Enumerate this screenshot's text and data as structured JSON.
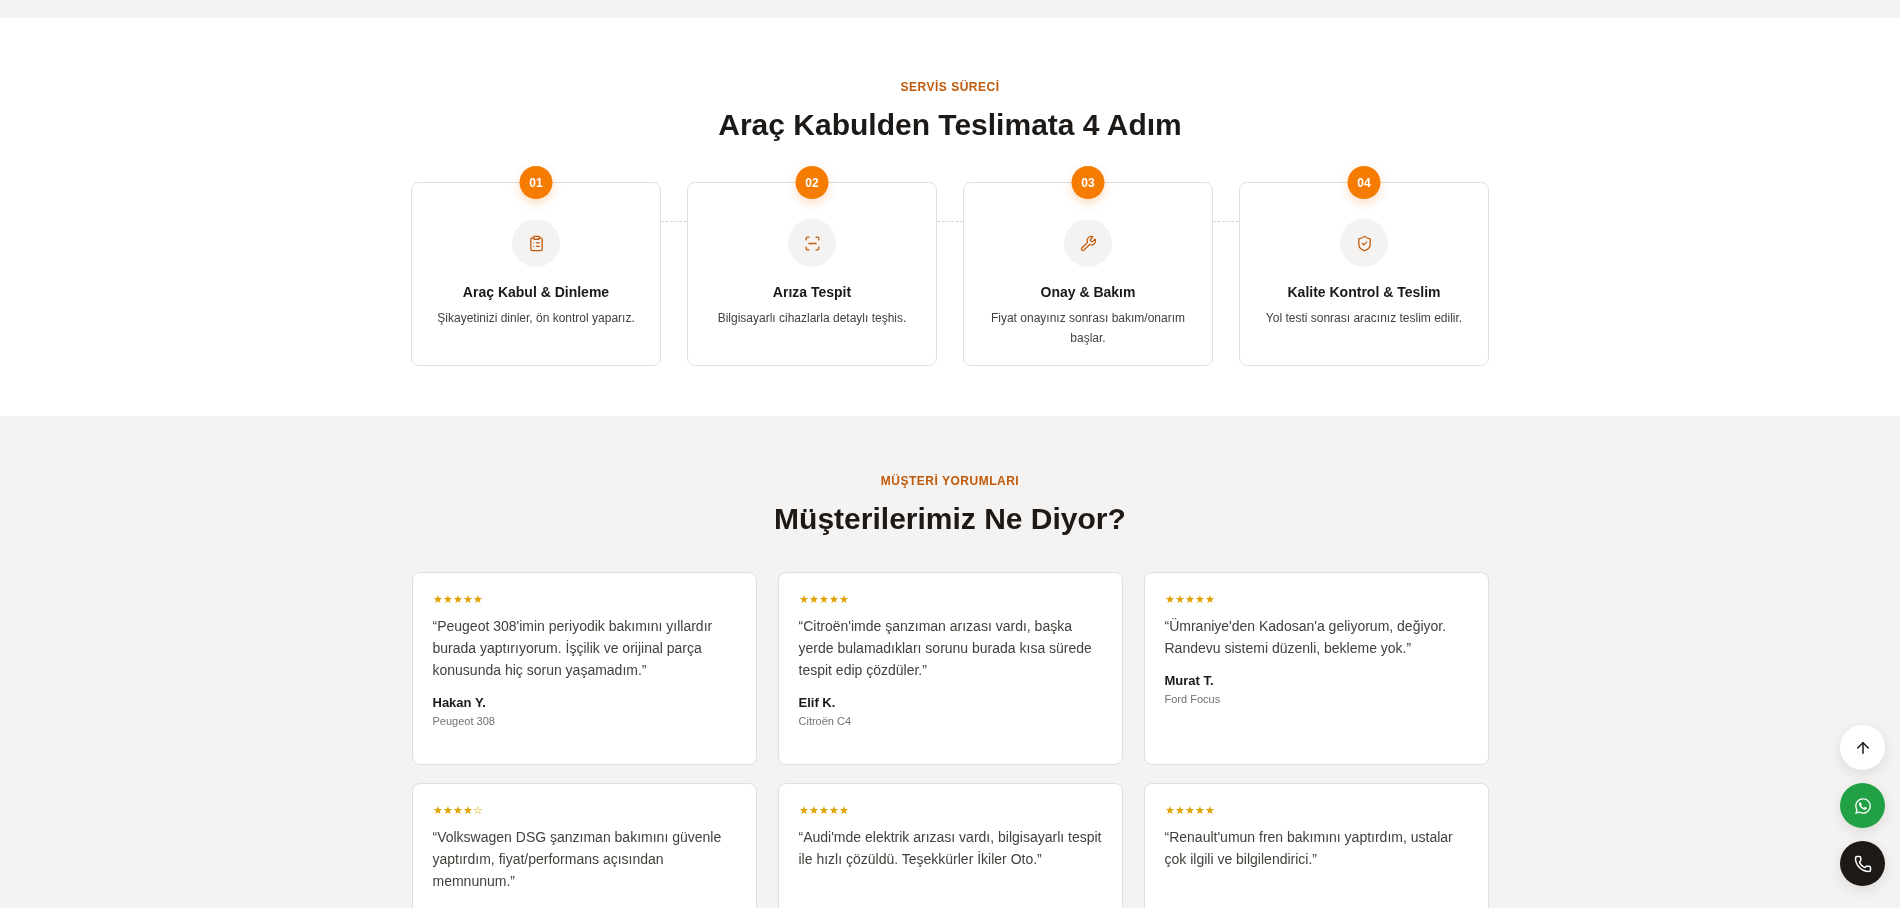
{
  "process": {
    "kicker": "SERVİS SÜRECİ",
    "title": "Araç Kabulden Teslimata 4 Adım",
    "steps": [
      {
        "number": "01",
        "title": "Araç Kabul & Dinleme",
        "text": "Şikayetinizi dinler, ön kontrol yaparız."
      },
      {
        "number": "02",
        "title": "Arıza Tespit",
        "text": "Bilgisayarlı cihazlarla detaylı teşhis."
      },
      {
        "number": "03",
        "title": "Onay & Bakım",
        "text": "Fiyat onayınız sonrası bakım/onarım başlar."
      },
      {
        "number": "04",
        "title": "Kalite Kontrol & Teslim",
        "text": "Yol testi sonrası aracınız teslim edilir."
      }
    ]
  },
  "reviews": {
    "kicker": "MÜŞTERİ YORUMLARI",
    "title": "Müşterilerimiz Ne Diyor?",
    "items": [
      {
        "stars": 5,
        "quote": "“Peugeot 308'imin periyodik bakımını yıllardır burada yaptırıyorum. İşçilik ve orijinal parça konusunda hiç sorun yaşamadım.”",
        "name": "Hakan Y.",
        "car": "Peugeot 308"
      },
      {
        "stars": 5,
        "quote": "“Citroën'imde şanzıman arızası vardı, başka yerde bulamadıkları sorunu burada kısa sürede tespit edip çözdüler.”",
        "name": "Elif K.",
        "car": "Citroën C4"
      },
      {
        "stars": 5,
        "quote": "“Ümraniye'den Kadosan'a geliyorum, değiyor. Randevu sistemi düzenli, bekleme yok.”",
        "name": "Murat T.",
        "car": "Ford Focus"
      },
      {
        "stars": 4,
        "quote": "“Volkswagen DSG şanzıman bakımını güvenle yaptırdım, fiyat/performans açısından memnunum.”"
      },
      {
        "stars": 5,
        "quote": "“Audi'mde elektrik arızası vardı, bilgisayarlı tespit ile hızlı çözüldü. Teşekkürler İkiler Oto.”"
      },
      {
        "stars": 5,
        "quote": "“Renault'umun fren bakımını yaptırdım, ustalar çok ilgili ve bilgilendirici.”"
      }
    ]
  },
  "floating_buttons": [
    {
      "kind": "top"
    },
    {
      "kind": "whatsapp"
    },
    {
      "kind": "phone"
    }
  ]
}
